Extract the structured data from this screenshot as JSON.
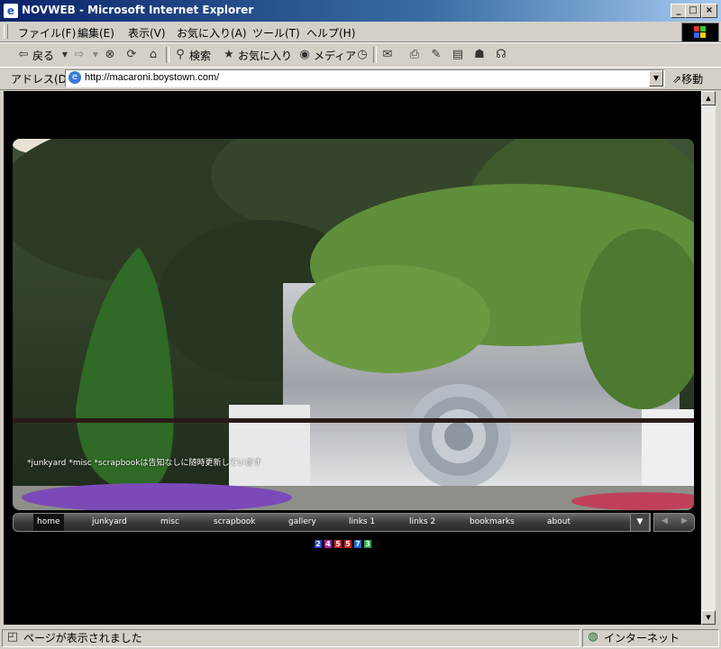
{
  "window": {
    "title": "NOVWEB - Microsoft Internet Explorer"
  },
  "menu": [
    "ファイル(F)",
    "編集(E)",
    "表示(V)",
    "お気に入り(A)",
    "ツール(T)",
    "ヘルプ(H)"
  ],
  "toolbar": {
    "back": "戻る",
    "search": "検索",
    "favorites": "お気に入り",
    "media": "メディア"
  },
  "address": {
    "label": "アドレス(D)",
    "url": "http://macaroni.boystown.com/",
    "go": "移動"
  },
  "page": {
    "caption": "*junkyard *misc *scrapbookは告知なしに随時更新しています",
    "nav": [
      "home",
      "junkyard",
      "misc",
      "scrapbook",
      "gallery",
      "links 1",
      "links 2",
      "bookmarks",
      "about"
    ],
    "counter": [
      "2",
      "4",
      "5",
      "5",
      "7",
      "3"
    ],
    "counter_colors": [
      "#2244cc",
      "#aa22aa",
      "#cc2222",
      "#cc2222",
      "#2266cc",
      "#22aa44"
    ]
  },
  "status": {
    "text": "ページが表示されました",
    "zone": "インターネット"
  },
  "colors": {
    "titlebar": "#0a246a",
    "chrome": "#d4d0c8",
    "page_bg": "#000000"
  }
}
